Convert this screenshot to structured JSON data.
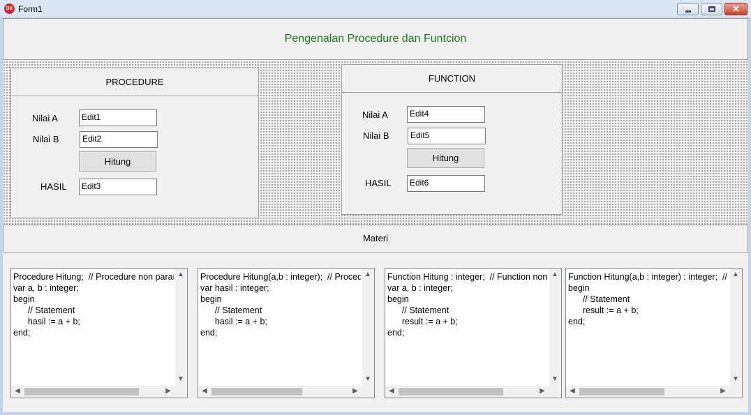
{
  "window": {
    "title": "Form1",
    "icon": "DX"
  },
  "header": {
    "title": "Pengenalan Procedure dan Funtcion"
  },
  "procedure_group": {
    "title": "PROCEDURE",
    "label_a": "Nilai A",
    "edit_a": "Edit1",
    "label_b": "Nilai B",
    "edit_b": "Edit2",
    "button": "Hitung",
    "label_result": "HASIL",
    "edit_result": "Edit3"
  },
  "function_group": {
    "title": "FUNCTION",
    "label_a": "Nilai A",
    "edit_a": "Edit4",
    "label_b": "Nilai B",
    "edit_b": "Edit5",
    "button": "Hitung",
    "label_result": "HASIL",
    "edit_result": "Edit6"
  },
  "materi": {
    "label": "Materi"
  },
  "memos": [
    {
      "text": "Procedure Hitung;  // Procedure non parameter\nvar a, b : integer;\nbegin\n      // Statement\n      hasil := a + b;\nend;"
    },
    {
      "text": "Procedure Hitung(a,b : integer);  // Procedure dengan parameter\nvar hasil : integer;\nbegin\n      // Statement\n      hasil := a + b;\nend;"
    },
    {
      "text": "Function Hitung : integer;  // Function non parameter\nvar a, b : integer;\nbegin\n      // Statement\n      result := a + b;\nend;"
    },
    {
      "text": "Function Hitung(a,b : integer) : integer;  // Function dengan parameter\nbegin\n      // Statement\n      result := a + b;\nend;"
    }
  ],
  "colors": {
    "title_green": "#1a7a1a",
    "close_red": "#c8432f"
  }
}
